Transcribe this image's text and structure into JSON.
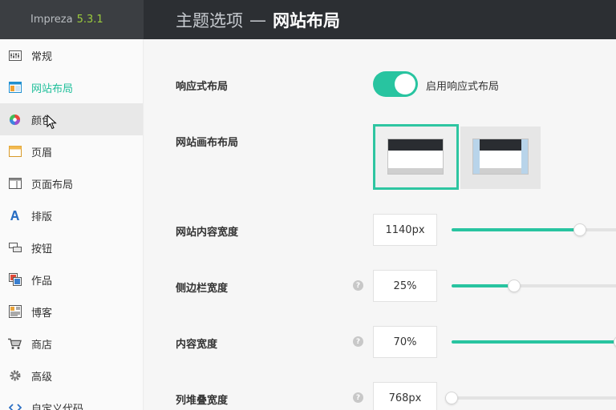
{
  "brand": {
    "name": "Impreza",
    "version": "5.3.1"
  },
  "header": {
    "parent": "主题选项",
    "separator": "—",
    "current": "网站布局"
  },
  "sidebar": {
    "items": [
      {
        "label": "常规",
        "icon": "general-settings-icon"
      },
      {
        "label": "网站布局",
        "icon": "layout-icon",
        "active": true
      },
      {
        "label": "颜色",
        "icon": "color-wheel-icon",
        "hover": true
      },
      {
        "label": "页眉",
        "icon": "header-icon"
      },
      {
        "label": "页面布局",
        "icon": "page-layout-icon"
      },
      {
        "label": "排版",
        "icon": "typography-icon"
      },
      {
        "label": "按钮",
        "icon": "button-icon"
      },
      {
        "label": "作品",
        "icon": "portfolio-icon"
      },
      {
        "label": "博客",
        "icon": "blog-icon"
      },
      {
        "label": "商店",
        "icon": "shop-cart-icon"
      },
      {
        "label": "高级",
        "icon": "gear-icon"
      },
      {
        "label": "自定义代码",
        "icon": "code-icon"
      }
    ]
  },
  "main": {
    "responsive": {
      "label": "响应式布局",
      "toggle_label": "启用响应式布局",
      "enabled": true
    },
    "canvas_layout": {
      "label": "网站画布布局",
      "options": [
        "wide",
        "boxed"
      ],
      "selected": "wide"
    },
    "content_width": {
      "label": "网站内容宽度",
      "value": "1140px",
      "slider_fraction": 0.76
    },
    "sidebar_width": {
      "label": "侧边栏宽度",
      "value": "25%",
      "slider_fraction": 0.37,
      "help": "?"
    },
    "content_area_width": {
      "label": "内容宽度",
      "value": "70%",
      "slider_fraction": 1.0,
      "help": "?"
    },
    "columns_stack_width": {
      "label": "列堆叠宽度",
      "value": "768px",
      "slider_fraction": 0.0,
      "help": "?"
    }
  },
  "colors": {
    "accent": "#28c4a0",
    "header_bg": "#2c2f33",
    "brand_bg": "#3b3e42",
    "version": "#9ccc3d"
  }
}
